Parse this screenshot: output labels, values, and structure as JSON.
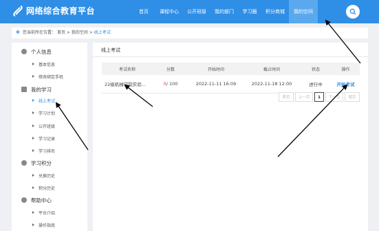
{
  "header": {
    "site_title": "网络综合教育平台",
    "nav": [
      "首页",
      "课程中心",
      "公开班级",
      "我的部门",
      "学习圈",
      "积分商城",
      "我的空间"
    ],
    "active_nav": "我的空间"
  },
  "breadcrumb": {
    "prefix": "您当前所在位置：",
    "items": [
      "首页",
      "我的空间",
      "线上考试"
    ],
    "sep": ">"
  },
  "sidebar": {
    "sections": [
      {
        "title": "个人信息",
        "icon": "user-icon",
        "items": [
          "基本信息",
          "修改绑定手机"
        ]
      },
      {
        "title": "我的学习",
        "icon": "book-icon",
        "items": [
          "线上考试",
          "学习计划",
          "公开班级",
          "学习记录",
          "学习排名"
        ]
      },
      {
        "title": "学习积分",
        "icon": "question-icon",
        "items": [
          "兑换历史",
          "积分历史"
        ]
      },
      {
        "title": "帮助中心",
        "icon": "help-icon",
        "items": [
          "平台介绍",
          "操作指南"
        ]
      }
    ],
    "active_item": "线上考试"
  },
  "main": {
    "title": "线上考试",
    "columns": [
      "考试名称",
      "分数",
      "开始时间",
      "截止时间",
      "状态",
      "操作"
    ],
    "rows": [
      {
        "name": "22级机械学院实验...",
        "score_got": "0",
        "score_total": " / 100",
        "start": "2022-11-11 16:09",
        "end": "2022-11-18 12:00",
        "status": "进行中",
        "action": "开始考试"
      }
    ],
    "pager": {
      "first": "首页",
      "prev": "上一页",
      "current": "1",
      "next": "下一页",
      "last": "尾页"
    }
  },
  "colors": {
    "primary": "#2f8ee5",
    "nav_active": "#5aa9ee",
    "score": "#e33333",
    "annotation": "#000000"
  }
}
